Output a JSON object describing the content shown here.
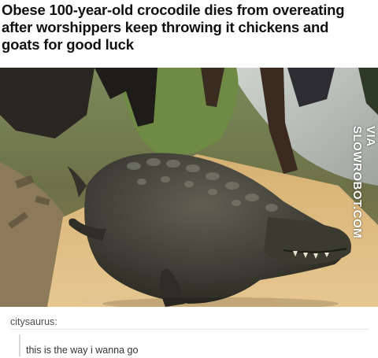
{
  "headline": {
    "line1": "Obese 100-year-old crocodile dies from overeating",
    "line2": "after worshippers keep throwing it chickens and",
    "line3": "goats for good luck"
  },
  "photo": {
    "watermark": "VIA SLOWROBOT.COM"
  },
  "post": {
    "username": "citysaurus:",
    "text": "this is the way i wanna go"
  },
  "colors": {
    "headline": "#111111",
    "username": "#4d4d4d",
    "body_text": "#333333",
    "quote_bar": "#d6d6d6"
  }
}
